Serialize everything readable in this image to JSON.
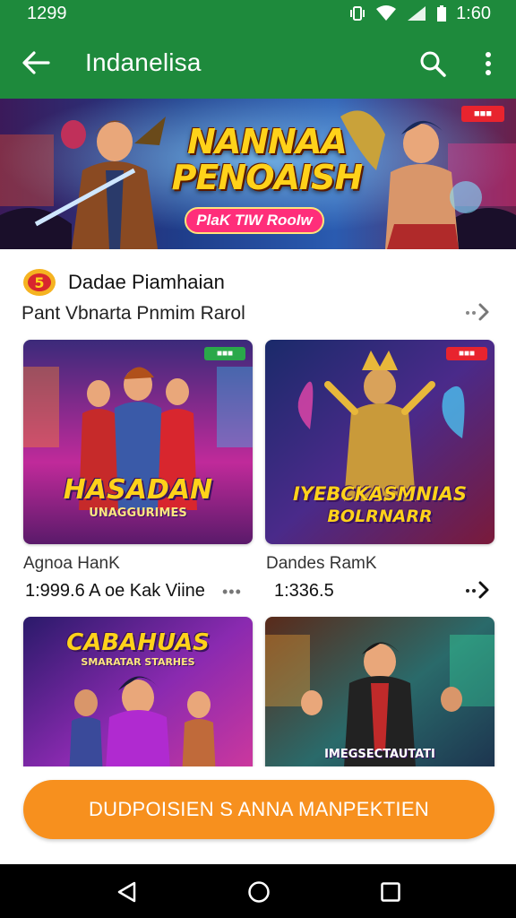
{
  "status": {
    "time_left": "1299",
    "time_right": "1:60"
  },
  "app_bar": {
    "title": "Indanelisa"
  },
  "hero": {
    "title_line1": "NANNAA",
    "title_line2": "PENOAISH",
    "button": "PlaK TIW RooIw"
  },
  "section": {
    "title": "Dadae Piamhaian",
    "subtitle": "Pant Vbnarta Pnmim Rarol"
  },
  "cards": [
    {
      "art_title": "HASADAN",
      "art_sub": "UNAGGURIMES",
      "name": "Agnoa HanK",
      "price": "1:999.6 A oe Kak Viine",
      "dots": "•••"
    },
    {
      "art_title": "IYEBCKASMNIAS",
      "art_sub": "BOLRNARR",
      "name": "Dandes RamK",
      "price": "1:336.5"
    },
    {
      "art_title": "CABAHUAS",
      "art_sub": "SMARATAR STARHES"
    },
    {
      "art_title": "",
      "art_sub": "IMEGSECTAUTATI"
    }
  ],
  "cta": {
    "label": "DUDPOISIEN S ANNA MANPEKTIEN"
  },
  "colors": {
    "app_bar": "#1e8a3c",
    "cta": "#f7901e",
    "hero_button": "#ff2e7a"
  }
}
